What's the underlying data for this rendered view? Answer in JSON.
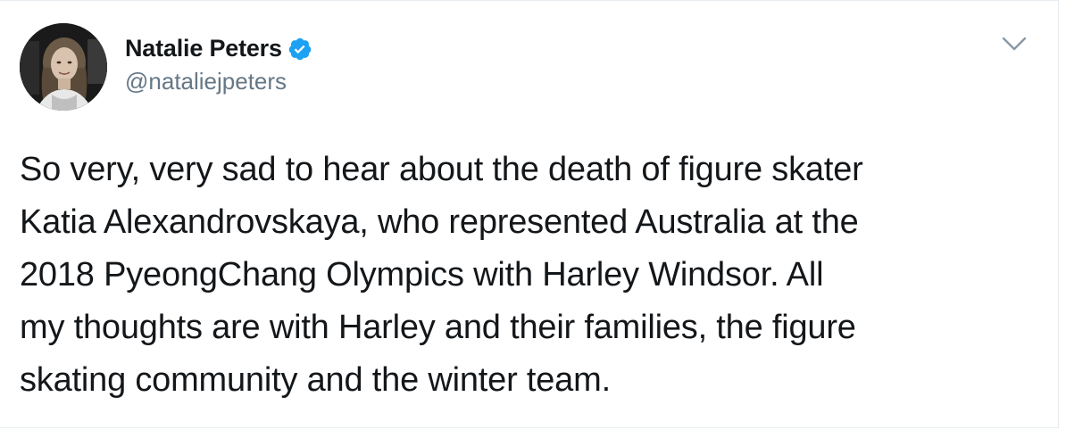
{
  "tweet": {
    "author": {
      "display_name": "Natalie Peters",
      "handle": "@nataliejpeters",
      "verified": true
    },
    "text": "So very, very sad to hear about the death of figure skater\nKatia Alexandrovskaya, who represented Australia at the\n2018 PyeongChang Olympics with Harley Windsor. All\nmy thoughts are with Harley and their families, the figure\nskating community and the winter team."
  },
  "colors": {
    "verified_blue": "#1da1f2",
    "handle_gray": "#657786",
    "text_dark": "#14171a",
    "chevron_gray": "#8899a6"
  },
  "icons": {
    "verified": "verified-badge-icon",
    "menu": "chevron-down-icon"
  }
}
